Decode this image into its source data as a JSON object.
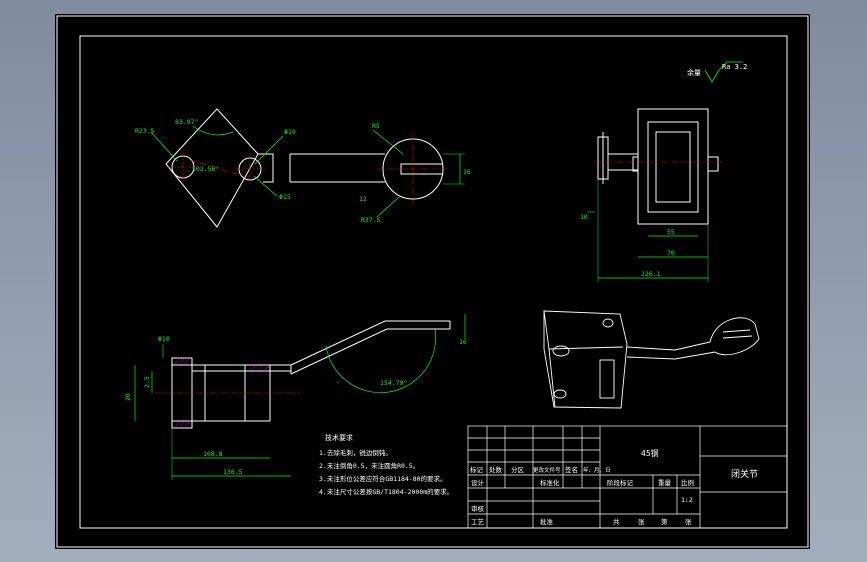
{
  "colors": {
    "background": "#000000",
    "frame": "#ffffff",
    "outline": "#ffffff",
    "dimension": "#00ff00",
    "centerline": "#ff0000",
    "hatch": "#ff00ff",
    "text": "#ffffff",
    "viewport_bg": "#8e9aac"
  },
  "roughness": {
    "prefix": "余量",
    "value": "Ra 3.2"
  },
  "top_view": {
    "dims": {
      "angle1": "83.97°",
      "r1": "R23.5",
      "r2": "R2.2",
      "phi1": "Φ10",
      "phi2": "Φ15",
      "angle2": "102.56°",
      "r3": "R5",
      "dim12": "12",
      "r4": "R37.5",
      "dim16": "16"
    }
  },
  "side_view": {
    "dims": {
      "h10": "10",
      "w55": "55",
      "w70": "70",
      "w1261": "126.1"
    }
  },
  "front_view": {
    "dims": {
      "phi10": "Φ10",
      "d25": "2.5",
      "d20": "20",
      "d108": "108.8",
      "d1365": "136.5",
      "angle": "154.79°",
      "d16": "16"
    }
  },
  "tech_notes": {
    "title": "技术要求",
    "items": [
      "1.去除毛刺，锐边倒钝。",
      "2.未注倒角0.5，未注圆角R0.5。",
      "3.未注形位公差应符合GB1184-80的要求。",
      "4.未注尺寸公差按GB/T1804-2000m的要求。"
    ]
  },
  "title_block": {
    "material": "45钢",
    "part_name": "闭关节",
    "row_labels": [
      "标记",
      "处数",
      "分区",
      "更改文件号",
      "签名",
      "年、月、日"
    ],
    "design": "设计",
    "standardize": "标准化",
    "stage_label": "阶段标记",
    "weight": "重量",
    "scale_label": "比例",
    "scale": "1:2",
    "audit": "审核",
    "process": "工艺",
    "approve": "批准",
    "sheets": [
      "共",
      "张",
      "第",
      "张"
    ]
  }
}
